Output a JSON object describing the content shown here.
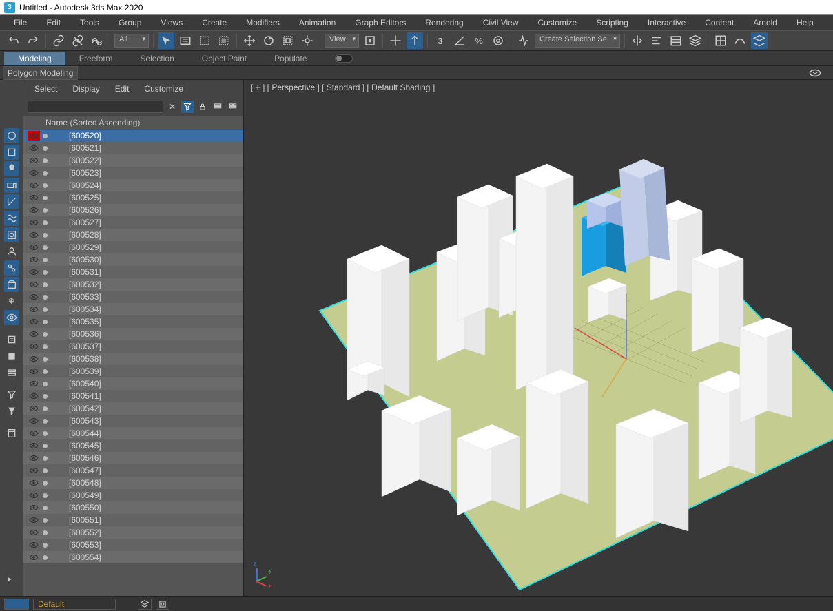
{
  "title": "Untitled - Autodesk 3ds Max 2020",
  "menu": [
    "File",
    "Edit",
    "Tools",
    "Group",
    "Views",
    "Create",
    "Modifiers",
    "Animation",
    "Graph Editors",
    "Rendering",
    "Civil View",
    "Customize",
    "Scripting",
    "Interactive",
    "Content",
    "Arnold",
    "Help"
  ],
  "toolbar": {
    "filter_dropdown": "All",
    "view_dropdown": "View",
    "selset_dropdown": "Create Selection Se"
  },
  "ribbon": {
    "tabs": [
      "Modeling",
      "Freeform",
      "Selection",
      "Object Paint",
      "Populate"
    ],
    "active_tab": "Modeling",
    "sub": "Polygon Modeling"
  },
  "explorer": {
    "menu": [
      "Select",
      "Display",
      "Edit",
      "Customize"
    ],
    "search_placeholder": "",
    "header": "Name (Sorted Ascending)",
    "selected": "[600520]",
    "items": [
      "[600520]",
      "[600521]",
      "[600522]",
      "[600523]",
      "[600524]",
      "[600525]",
      "[600526]",
      "[600527]",
      "[600528]",
      "[600529]",
      "[600530]",
      "[600531]",
      "[600532]",
      "[600533]",
      "[600534]",
      "[600535]",
      "[600536]",
      "[600537]",
      "[600538]",
      "[600539]",
      "[600540]",
      "[600541]",
      "[600542]",
      "[600543]",
      "[600544]",
      "[600545]",
      "[600546]",
      "[600547]",
      "[600548]",
      "[600549]",
      "[600550]",
      "[600551]",
      "[600552]",
      "[600553]",
      "[600554]"
    ]
  },
  "viewport": {
    "label": "[ + ] [ Perspective ] [ Standard ] [ Default Shading ]"
  },
  "axes": {
    "x": "x",
    "y": "y",
    "z": "z"
  },
  "status": {
    "layer": "Default"
  }
}
